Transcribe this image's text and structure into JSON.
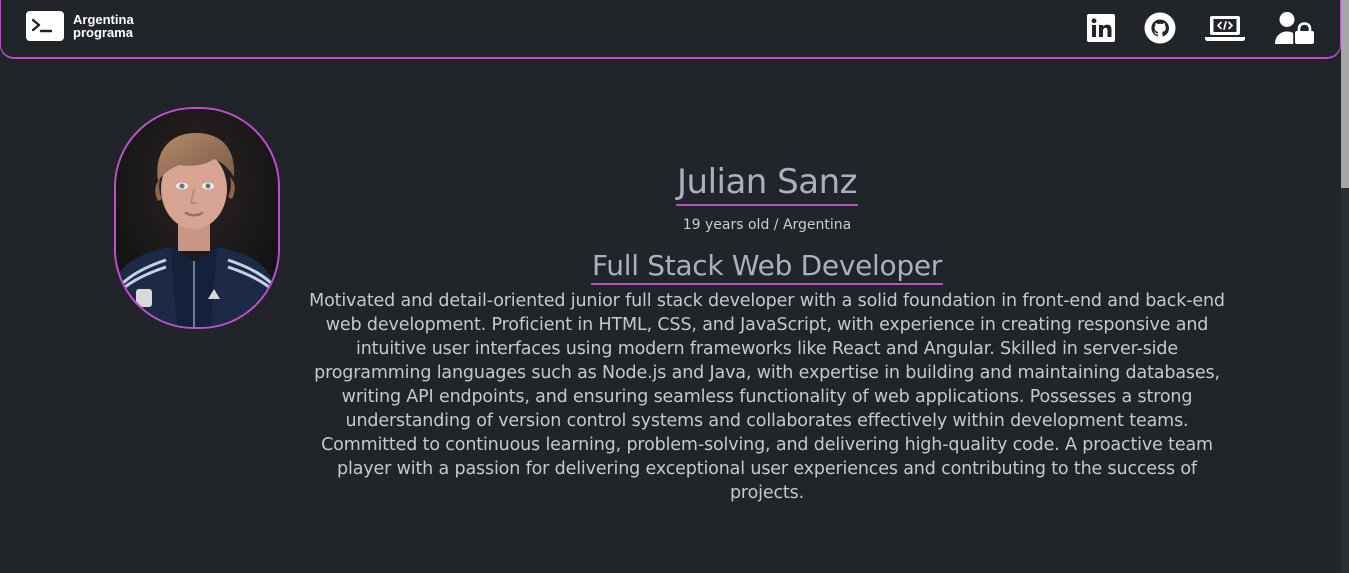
{
  "header": {
    "brand_line1": "Argentina",
    "brand_line2": "programa",
    "icons": [
      "linkedin-icon",
      "github-icon",
      "laptop-code-icon",
      "user-lock-icon"
    ]
  },
  "profile": {
    "name": "Julian Sanz",
    "subtitle": "19 years old / Argentina",
    "role": "Full Stack Web Developer",
    "bio": "Motivated and detail-oriented junior full stack developer with a solid foundation in front-end and back-end web development. Proficient in HTML, CSS, and JavaScript, with experience in creating responsive and intuitive user interfaces using modern frameworks like React and Angular. Skilled in server-side programming languages such as Node.js and Java, with expertise in building and maintaining databases, writing API endpoints, and ensuring seamless functionality of web applications. Possesses a strong understanding of version control systems and collaborates effectively within development teams. Committed to continuous learning, problem-solving, and delivering high-quality code. A proactive team player with a passion for delivering exceptional user experiences and contributing to the success of projects."
  },
  "colors": {
    "background": "#212429",
    "accent": "#b84fc4",
    "text": "#c9ccd4"
  }
}
